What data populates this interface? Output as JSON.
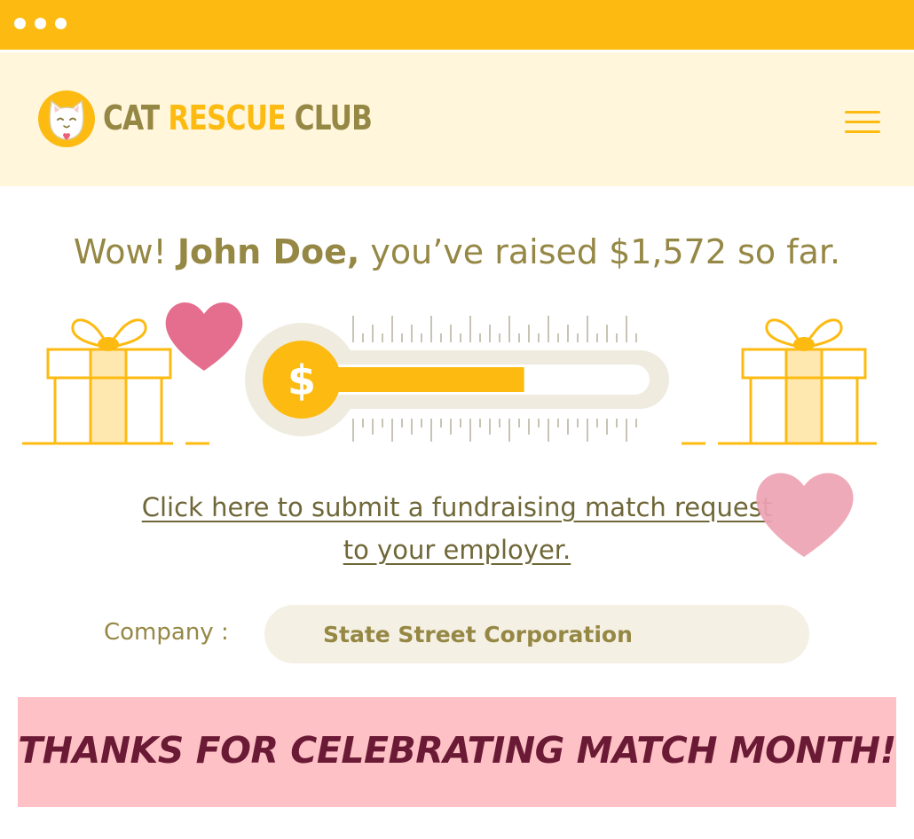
{
  "window": {
    "controls": [
      "window-dot",
      "window-dot",
      "window-dot"
    ]
  },
  "header": {
    "logo_words": [
      "CAT",
      "RESCUE",
      "CLUB"
    ],
    "logo_icon": "cat-face-icon",
    "menu_icon": "hamburger-menu-icon"
  },
  "headline": {
    "prefix": "Wow! ",
    "name": "John Doe,",
    "suffix": " you’ve raised $1,572 so far."
  },
  "progress": {
    "fill_fraction": 0.62,
    "icon": "dollar-icon"
  },
  "decorations": [
    "gift-icon",
    "heart-icon",
    "gift-icon",
    "heart-icon"
  ],
  "match_link": {
    "line1": "Click here to submit a fundraising match request",
    "line2": "to your employer."
  },
  "company": {
    "label": "Company :",
    "value": "State Street Corporation"
  },
  "banner": {
    "text": "THANKS FOR CELEBRATING MATCH MONTH!"
  },
  "colors": {
    "accent": "#fdbb12",
    "header_bg": "#fff6dc",
    "olive_text": "#958744",
    "link_text": "#6f6738",
    "banner_bg": "#fec2c6",
    "banner_text": "#6b1a35",
    "heart_dark": "#e56d8d",
    "heart_light": "#eea3b3"
  }
}
